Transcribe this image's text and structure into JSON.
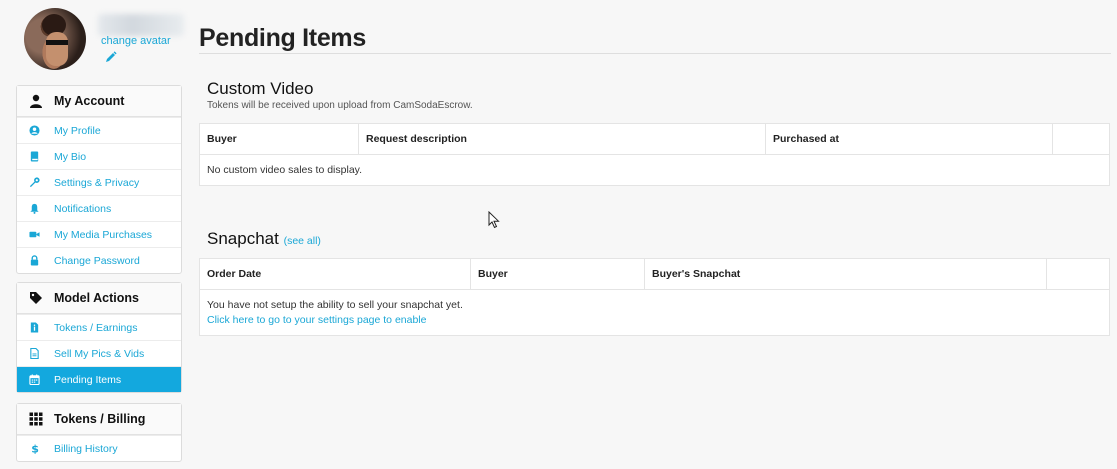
{
  "profile": {
    "change_avatar_label": "change avatar"
  },
  "sidebar": {
    "my_account": {
      "title": "My Account",
      "items": [
        {
          "label": "My Profile",
          "icon": "user-circle-icon"
        },
        {
          "label": "My Bio",
          "icon": "book-icon"
        },
        {
          "label": "Settings & Privacy",
          "icon": "wrench-icon"
        },
        {
          "label": "Notifications",
          "icon": "bell-icon"
        },
        {
          "label": "My Media Purchases",
          "icon": "video-camera-icon"
        },
        {
          "label": "Change Password",
          "icon": "lock-icon"
        }
      ]
    },
    "model_actions": {
      "title": "Model Actions",
      "items": [
        {
          "label": "Tokens / Earnings",
          "icon": "info-doc-icon"
        },
        {
          "label": "Sell My Pics & Vids",
          "icon": "file-icon"
        },
        {
          "label": "Pending Items",
          "icon": "calendar-icon",
          "active": true
        }
      ]
    },
    "tokens_billing": {
      "title": "Tokens / Billing",
      "items": [
        {
          "label": "Billing History",
          "icon": "dollar-icon"
        }
      ]
    }
  },
  "main": {
    "page_title": "Pending Items",
    "custom_video": {
      "title": "Custom Video",
      "subtitle": "Tokens will be received upon upload from CamSodaEscrow.",
      "columns": [
        "Buyer",
        "Request description",
        "Purchased at",
        ""
      ],
      "empty_message": "No custom video sales to display."
    },
    "snapchat": {
      "title": "Snapchat",
      "see_all_label": "(see all)",
      "columns": [
        "Order Date",
        "Buyer",
        "Buyer's Snapchat",
        ""
      ],
      "message": "You have not setup the ability to sell your snapchat yet.",
      "link_label": "Click here to go to your settings page to enable"
    }
  },
  "colors": {
    "accent": "#1aa7d6",
    "active_bg": "#13a8de",
    "background": "#f7f7f7"
  }
}
